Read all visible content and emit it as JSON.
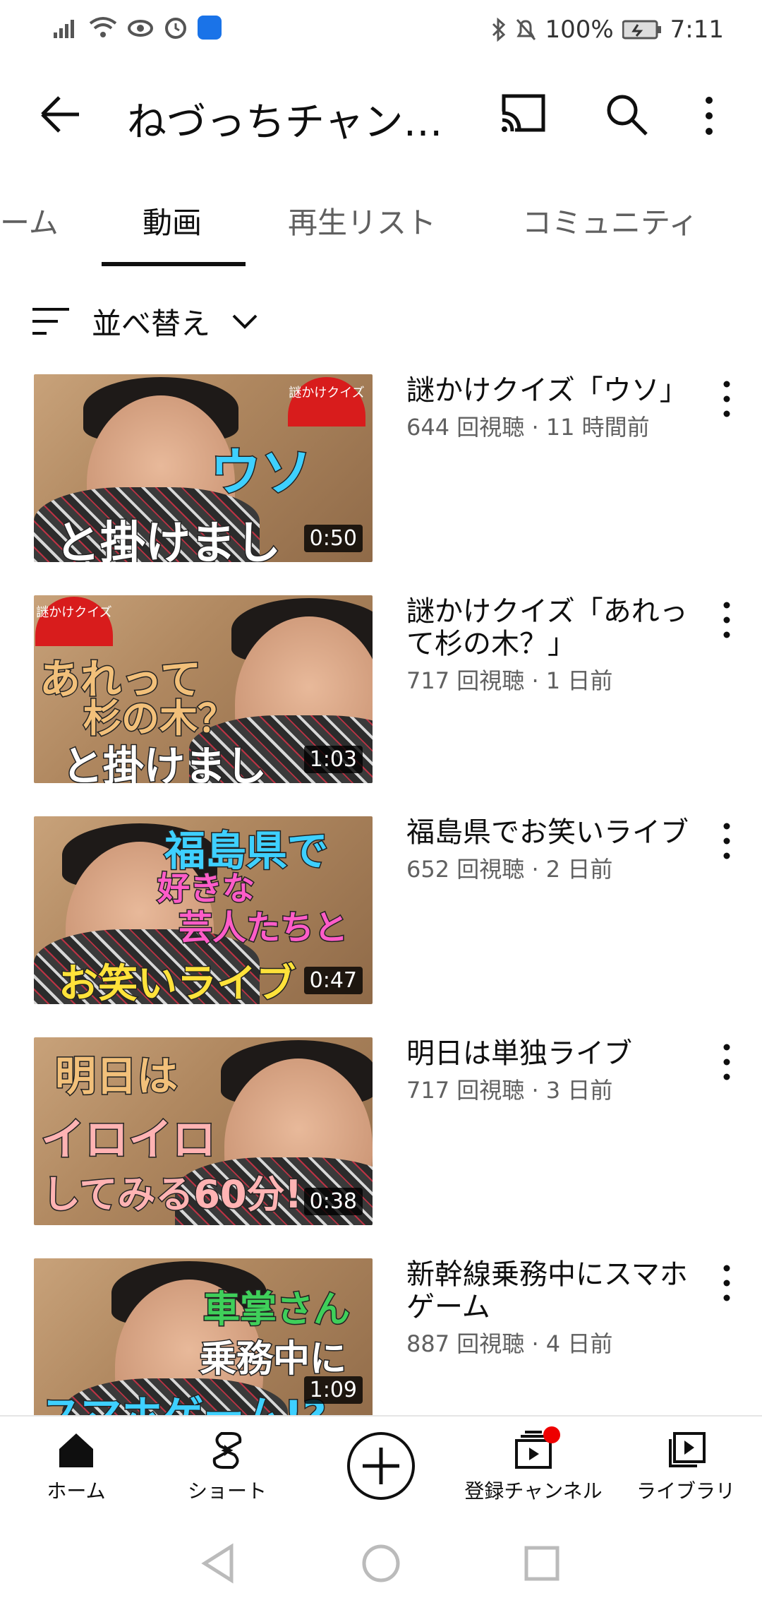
{
  "status_bar": {
    "battery": "100%",
    "time": "7:11"
  },
  "app_bar": {
    "title": "ねづっちチャン…"
  },
  "tabs": [
    {
      "label": "ーム"
    },
    {
      "label": "動画",
      "active": true
    },
    {
      "label": "再生リスト"
    },
    {
      "label": "コミュニティ"
    }
  ],
  "sort": {
    "label": "並べ替え"
  },
  "videos": [
    {
      "title": "謎かけクイズ「ウソ」",
      "views": "644 回視聴",
      "age": "11 時間前",
      "duration": "0:50",
      "caption_top": "ウソ",
      "caption_bottom": "と掛けまし",
      "fan": "謎かけクイズ"
    },
    {
      "title": "謎かけクイズ「あれって杉の木？」",
      "views": "717 回視聴",
      "age": "1 日前",
      "duration": "1:03",
      "caption_top": "あれって",
      "caption_mid": "杉の木？",
      "caption_bottom": "と掛けまし",
      "fan": "謎かけクイズ"
    },
    {
      "title": "福島県でお笑いライブ",
      "views": "652 回視聴",
      "age": "2 日前",
      "duration": "0:47",
      "caption_top": "福島県で",
      "caption_mid": "好きな",
      "caption_mid2": "芸人たちと",
      "caption_bottom": "お笑いライブ"
    },
    {
      "title": "明日は単独ライブ",
      "views": "717 回視聴",
      "age": "3 日前",
      "duration": "0:38",
      "caption_top": "明日は",
      "caption_mid": "イロイロ",
      "caption_bottom": "してみる60分!"
    },
    {
      "title": "新幹線乗務中にスマホゲーム",
      "views": "887 回視聴",
      "age": "4 日前",
      "duration": "1:09",
      "caption_top": "車掌さん",
      "caption_mid": "乗務中に",
      "caption_bottom": "スマホゲーム!?"
    }
  ],
  "bottom_nav": [
    {
      "label": "ホーム",
      "icon": "home-icon"
    },
    {
      "label": "ショート",
      "icon": "shorts-icon"
    },
    {
      "label": "",
      "icon": "create-icon"
    },
    {
      "label": "登録チャンネル",
      "icon": "subscriptions-icon"
    },
    {
      "label": "ライブラリ",
      "icon": "library-icon"
    }
  ],
  "colors": {
    "text_primary": "#0f0f0f",
    "text_secondary": "#606060",
    "notification_dot": "#ee0000"
  }
}
